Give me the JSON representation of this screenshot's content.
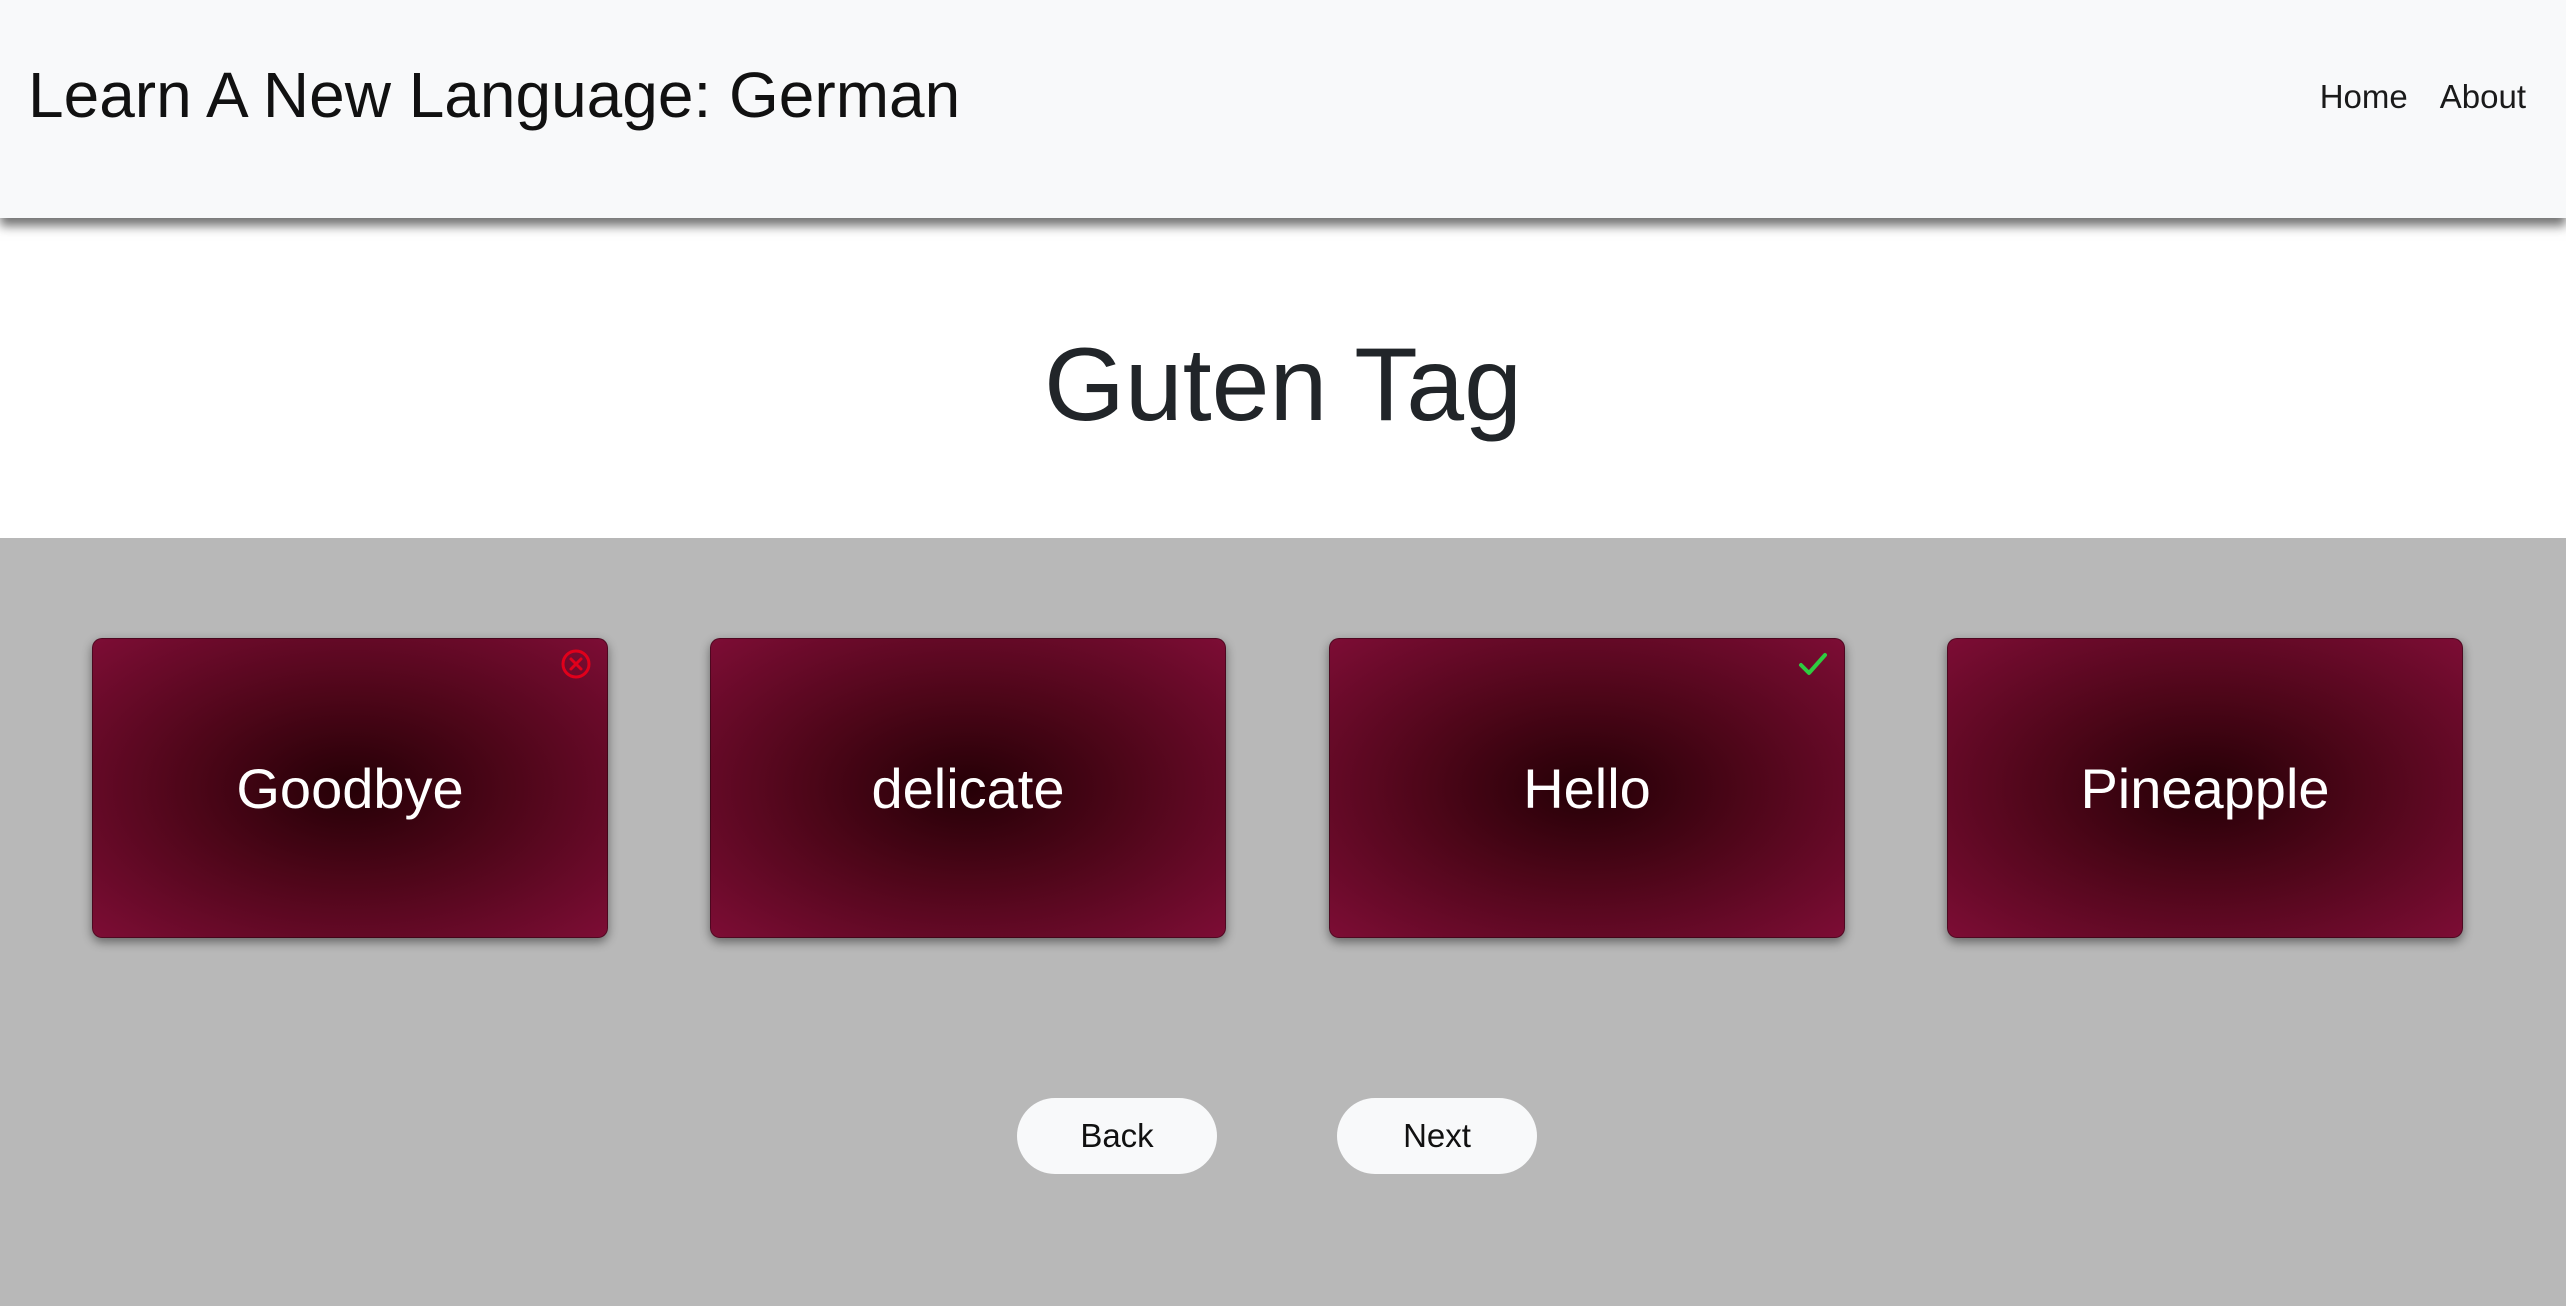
{
  "header": {
    "title": "Learn A New Language: German",
    "nav": [
      {
        "label": "Home"
      },
      {
        "label": "About"
      }
    ]
  },
  "quiz": {
    "word": "Guten Tag",
    "options": [
      {
        "label": "Goodbye",
        "status": "incorrect",
        "icon": "x-circle-icon"
      },
      {
        "label": "delicate",
        "status": "none",
        "icon": ""
      },
      {
        "label": "Hello",
        "status": "correct",
        "icon": "checkmark-icon"
      },
      {
        "label": "Pineapple",
        "status": "none",
        "icon": ""
      }
    ]
  },
  "controls": {
    "back_label": "Back",
    "next_label": "Next"
  },
  "colors": {
    "incorrect": "#e0001b",
    "correct": "#2ecc40",
    "card_edge": "#7d0d35",
    "card_center": "#250006",
    "stage_bg": "#b8b8b8"
  }
}
